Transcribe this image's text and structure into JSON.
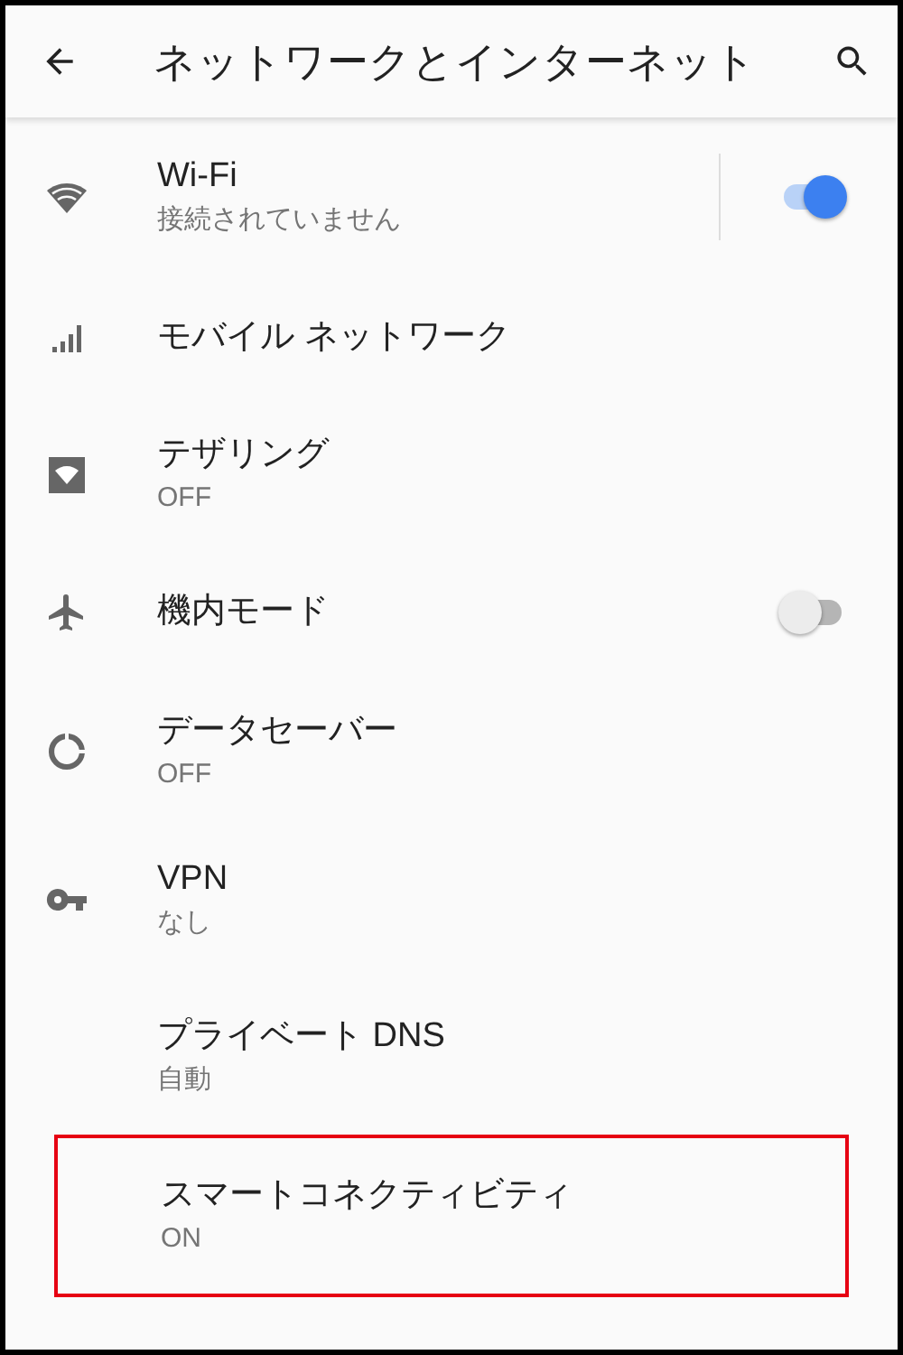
{
  "header": {
    "title": "ネットワークとインターネット"
  },
  "items": [
    {
      "kind": "switch",
      "title": "Wi-Fi",
      "subtitle": "接続されていません",
      "on": true,
      "highlighted": false
    },
    {
      "kind": "plain",
      "title": "モバイル ネットワーク",
      "highlighted": false
    },
    {
      "kind": "plain",
      "title": "テザリング",
      "subtitle": "OFF",
      "highlighted": false
    },
    {
      "kind": "switch",
      "title": "機内モード",
      "on": false,
      "highlighted": false
    },
    {
      "kind": "plain",
      "title": "データセーバー",
      "subtitle": "OFF",
      "highlighted": false
    },
    {
      "kind": "plain",
      "title": "VPN",
      "subtitle": "なし",
      "highlighted": false
    },
    {
      "kind": "plain",
      "title": "プライベート DNS",
      "subtitle": "自動",
      "highlighted": false
    },
    {
      "kind": "plain",
      "title": "スマートコネクティビティ",
      "subtitle": "ON",
      "highlighted": true
    }
  ]
}
